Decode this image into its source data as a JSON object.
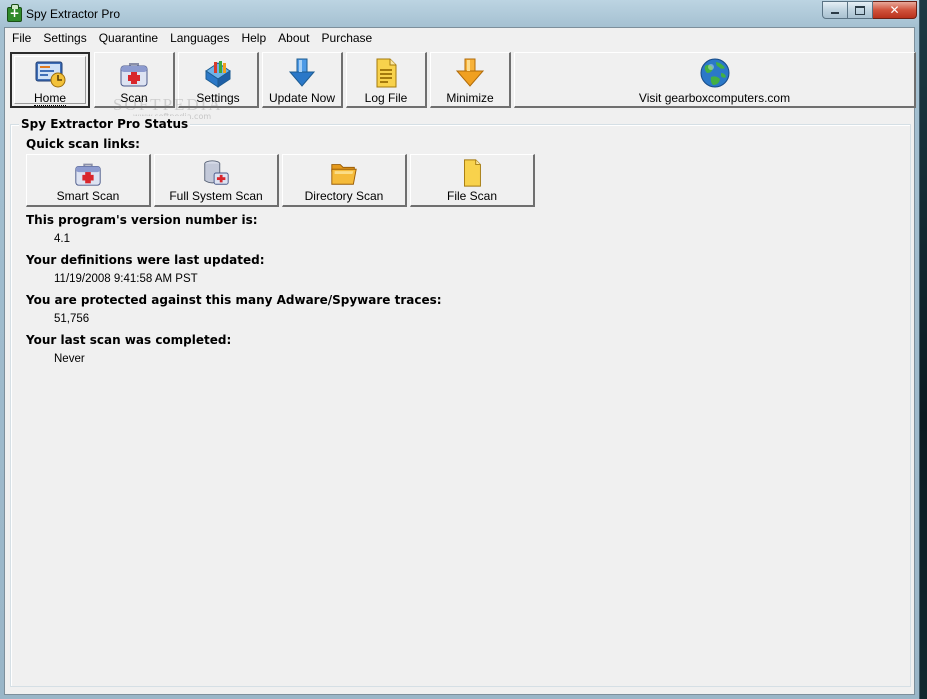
{
  "window": {
    "title": "Spy Extractor Pro"
  },
  "menu": [
    "File",
    "Settings",
    "Quarantine",
    "Languages",
    "Help",
    "About",
    "Purchase"
  ],
  "toolbar": {
    "home": "Home",
    "scan": "Scan",
    "settings": "Settings",
    "update": "Update Now",
    "log": "Log File",
    "minimize": "Minimize",
    "visit": "Visit gearboxcomputers.com"
  },
  "watermark": {
    "text": "SOFTPEDIA",
    "sub": "www.softpedia.com"
  },
  "status": {
    "group_title": "Spy Extractor Pro Status",
    "quick_label": "Quick scan links:",
    "quick": {
      "smart": "Smart Scan",
      "full": "Full System Scan",
      "directory": "Directory Scan",
      "file": "File Scan"
    },
    "version_label": "This program's version number is:",
    "version_value": "4.1",
    "defs_label": "Your definitions were last updated:",
    "defs_value": "11/19/2008 9:41:58 AM PST",
    "traces_label": "You are protected against this many Adware/Spyware traces:",
    "traces_value": "51,756",
    "lastscan_label": "Your last scan was completed:",
    "lastscan_value": "Never"
  },
  "icons": {
    "home": "home-screen-icon",
    "scan": "medical-kit-icon",
    "settings": "toolbox-icon",
    "update": "download-arrow-icon",
    "log": "document-icon",
    "minimize": "down-arrow-icon",
    "visit": "globe-icon"
  },
  "colors": {
    "face": "#f0f0f0",
    "accent_blue": "#2b78c8",
    "accent_orange": "#f0a020"
  }
}
